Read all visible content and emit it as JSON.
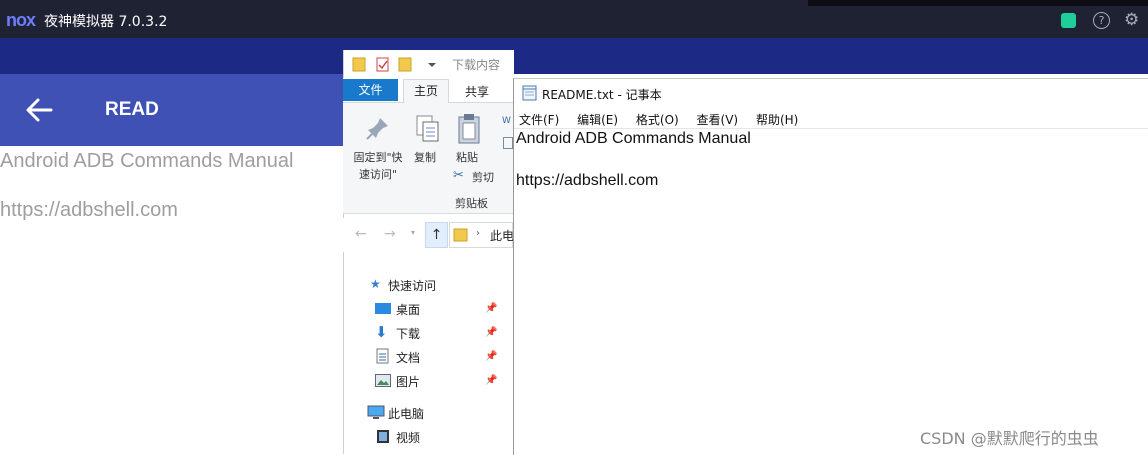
{
  "nox": {
    "logo": "nox",
    "title": "夜神模拟器 7.0.3.2",
    "app_title": "READ",
    "lines": [
      "Android ADB Commands Manual",
      "https://adbshell.com"
    ],
    "colors": {
      "title_bar": "#1f2233",
      "app_bar": "#3f51b5",
      "strip": "#1c2a86"
    }
  },
  "explorer": {
    "window_title": "下载内容",
    "tabs": [
      "文件",
      "主页",
      "共享"
    ],
    "ribbon": {
      "pin": "固定到\"快速访问\"",
      "copy": "复制",
      "paste": "粘贴",
      "cut": "剪切",
      "group": "剪贴板"
    },
    "address_crumb": "此电",
    "nav": [
      {
        "label": "快速访问",
        "icon": "star-icon"
      },
      {
        "label": "桌面",
        "icon": "desktop-icon",
        "pinned": true
      },
      {
        "label": "下载",
        "icon": "download-icon",
        "pinned": true
      },
      {
        "label": "文档",
        "icon": "document-icon",
        "pinned": true
      },
      {
        "label": "图片",
        "icon": "picture-icon",
        "pinned": true
      },
      {
        "label": "此电脑",
        "icon": "computer-icon"
      },
      {
        "label": "视频",
        "icon": "video-icon"
      }
    ]
  },
  "notepad": {
    "title": "README.txt - 记事本",
    "menu": [
      "文件(F)",
      "编辑(E)",
      "格式(O)",
      "查看(V)",
      "帮助(H)"
    ],
    "content": [
      "Android ADB Commands Manual",
      "https://adbshell.com"
    ]
  },
  "watermark": "CSDN @默默爬行的虫虫"
}
